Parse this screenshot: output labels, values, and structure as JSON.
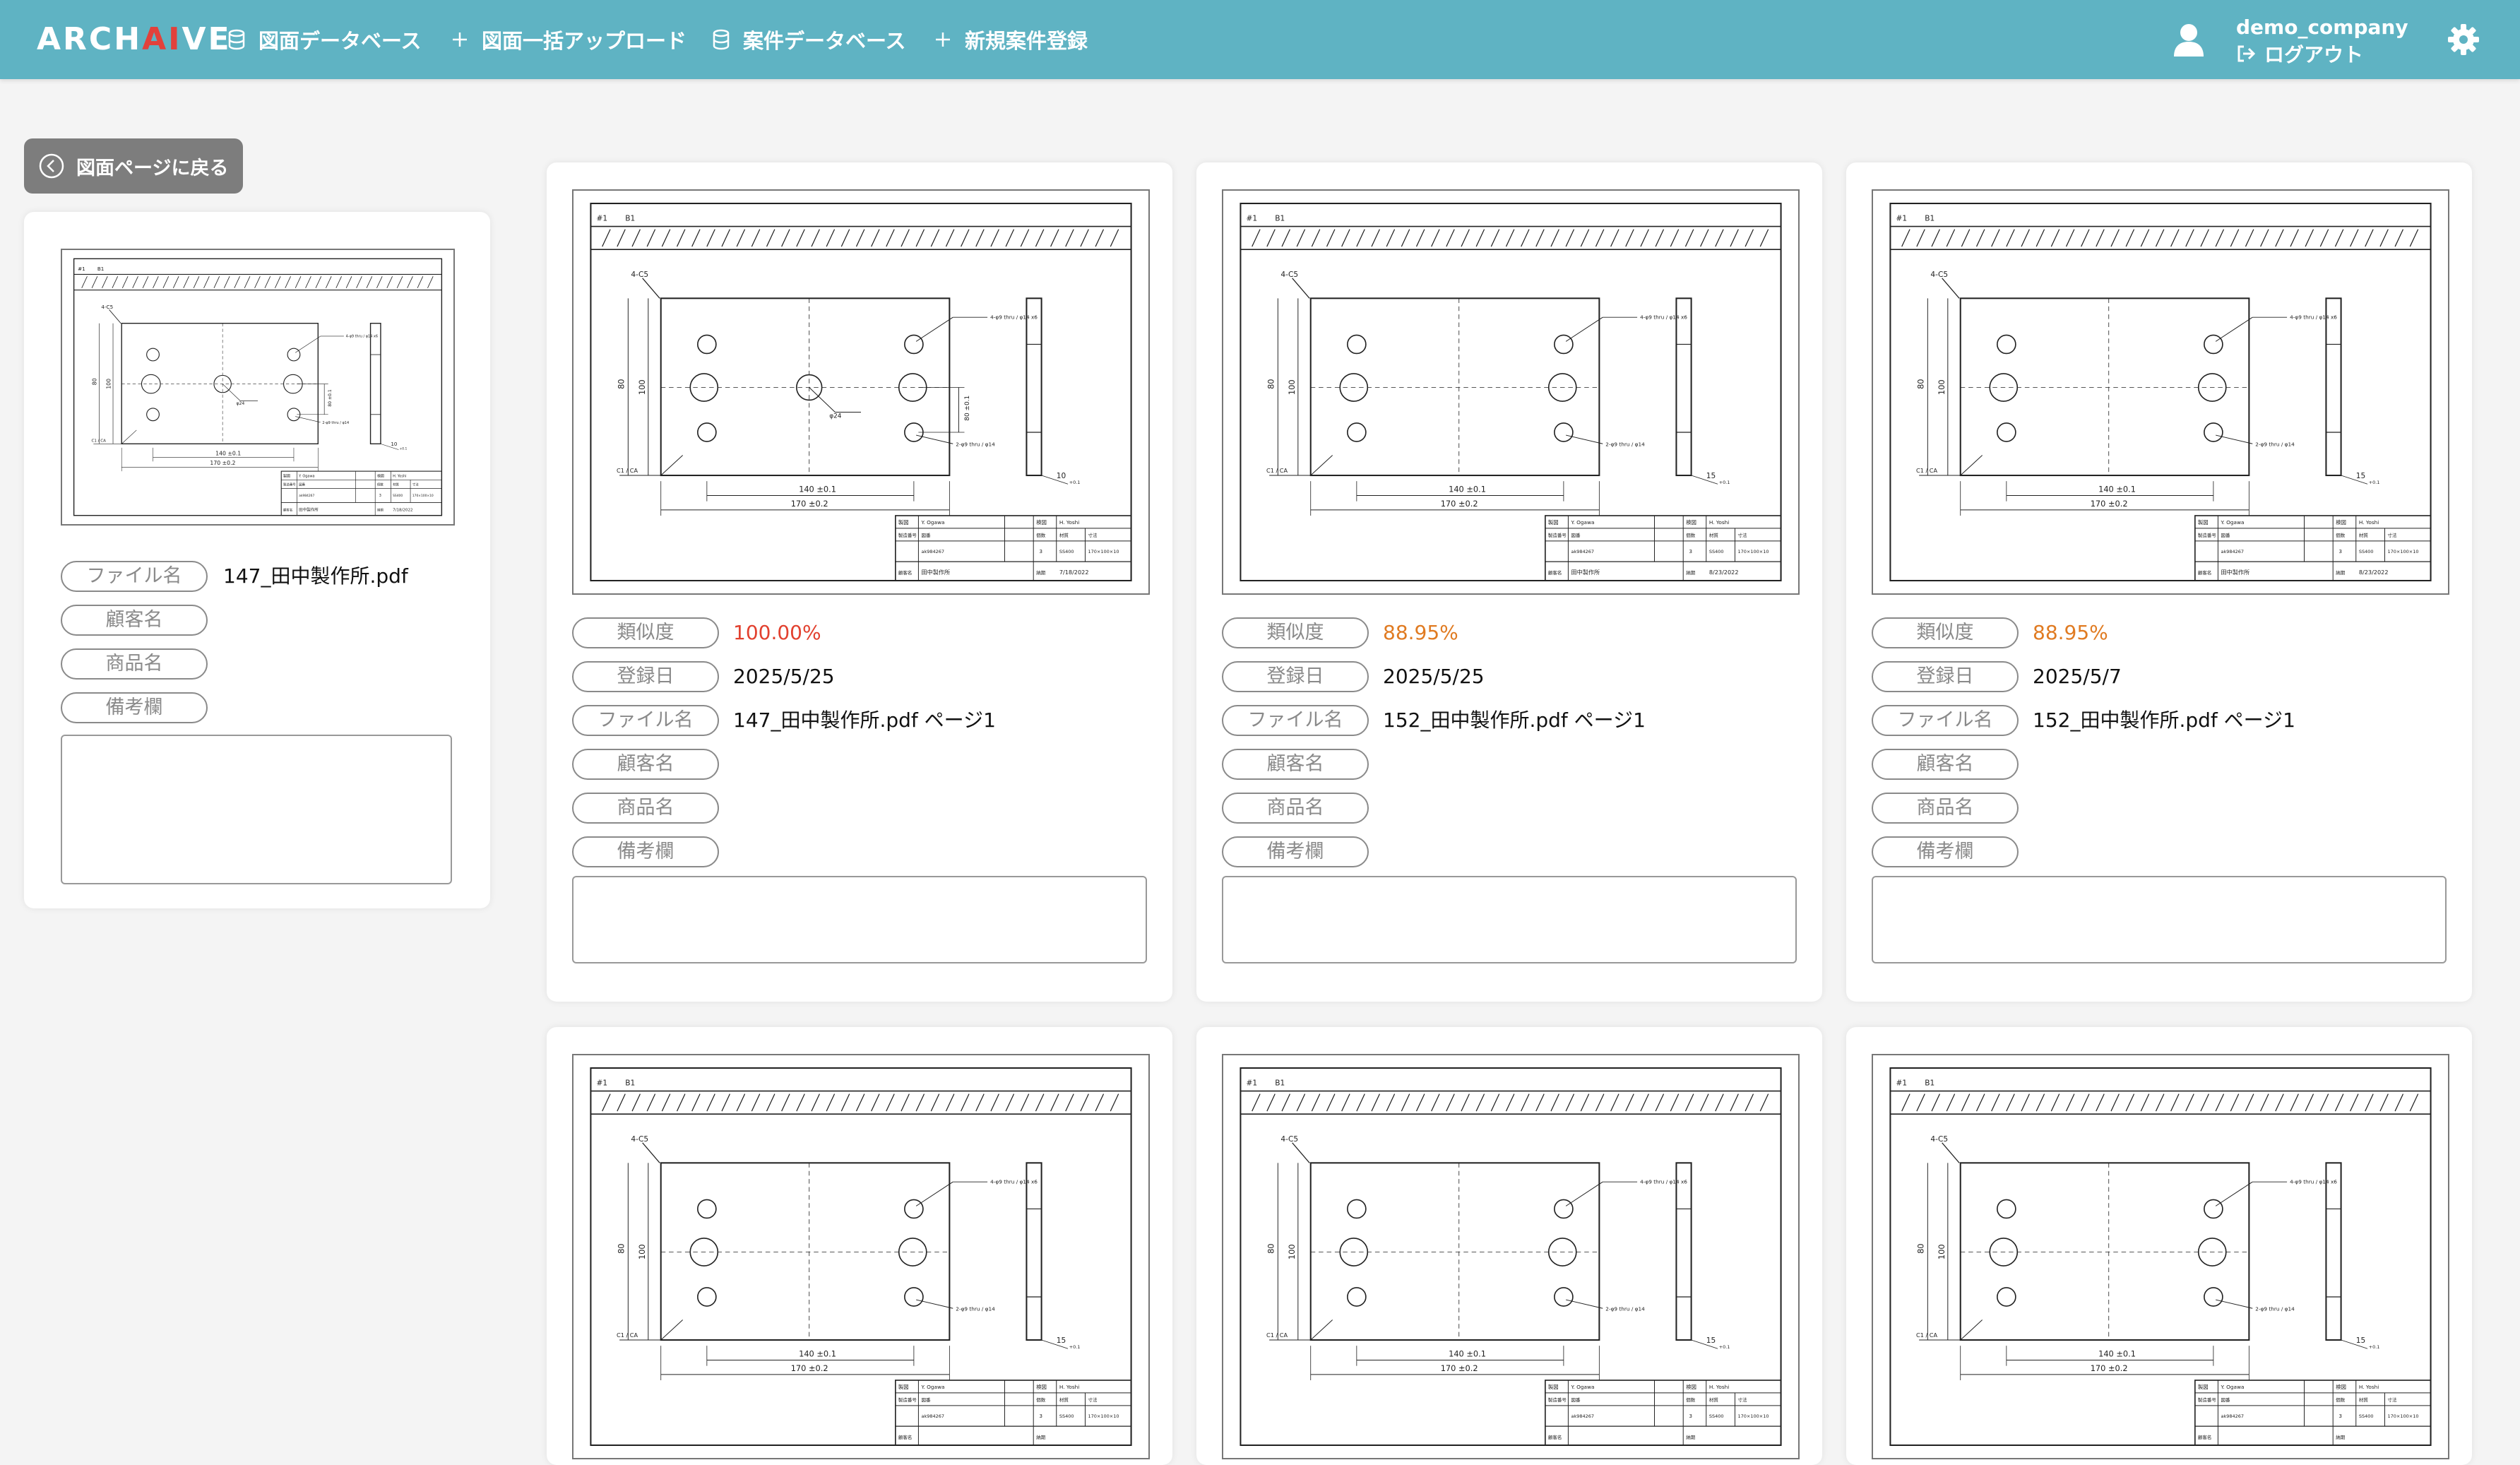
{
  "header": {
    "logo": {
      "prefix": "ARCH",
      "highlight": "AI",
      "suffix": "VE"
    },
    "nav": [
      {
        "label": "図面データベース",
        "icon": "database-icon"
      },
      {
        "label": "図面一括アップロード",
        "icon": "plus-icon"
      },
      {
        "label": "案件データベース",
        "icon": "database-icon"
      },
      {
        "label": "新規案件登録",
        "icon": "plus-icon"
      }
    ],
    "user": {
      "name": "demo_company",
      "logout_label": "ログアウト"
    }
  },
  "back_button": {
    "label": "図面ページに戻る"
  },
  "source": {
    "fields": [
      {
        "label": "ファイル名",
        "value": "147_田中製作所.pdf"
      },
      {
        "label": "顧客名",
        "value": ""
      },
      {
        "label": "商品名",
        "value": ""
      },
      {
        "label": "備考欄",
        "value": ""
      }
    ],
    "drawing": {
      "width_dim": "140",
      "total_dim": "170",
      "height_dim": "100",
      "inner_dim": "80",
      "thickness": "10",
      "date": "7/18/2022",
      "company": "田中製作所"
    }
  },
  "results": [
    {
      "similarity_label": "類似度",
      "similarity": "100.00%",
      "level": "red",
      "fields": [
        {
          "label": "登録日",
          "value": "2025/5/25"
        },
        {
          "label": "ファイル名",
          "value": "147_田中製作所.pdf ページ1"
        },
        {
          "label": "顧客名",
          "value": ""
        },
        {
          "label": "商品名",
          "value": ""
        },
        {
          "label": "備考欄",
          "value": ""
        }
      ],
      "drawing": {
        "width_dim": "140",
        "total_dim": "170",
        "height_dim": "100",
        "inner_dim": "80",
        "thickness": "10",
        "date": "7/18/2022",
        "company": "田中製作所"
      }
    },
    {
      "similarity_label": "類似度",
      "similarity": "88.95%",
      "level": "orange",
      "fields": [
        {
          "label": "登録日",
          "value": "2025/5/25"
        },
        {
          "label": "ファイル名",
          "value": "152_田中製作所.pdf ページ1"
        },
        {
          "label": "顧客名",
          "value": ""
        },
        {
          "label": "商品名",
          "value": ""
        },
        {
          "label": "備考欄",
          "value": ""
        }
      ],
      "drawing": {
        "width_dim": "140",
        "total_dim": "170",
        "height_dim": "100",
        "inner_dim": "80",
        "thickness": "15",
        "date": "8/23/2022",
        "company": "田中製作所"
      }
    },
    {
      "similarity_label": "類似度",
      "similarity": "88.95%",
      "level": "orange",
      "fields": [
        {
          "label": "登録日",
          "value": "2025/5/7"
        },
        {
          "label": "ファイル名",
          "value": "152_田中製作所.pdf ページ1"
        },
        {
          "label": "顧客名",
          "value": ""
        },
        {
          "label": "商品名",
          "value": ""
        },
        {
          "label": "備考欄",
          "value": ""
        }
      ],
      "drawing": {
        "width_dim": "140",
        "total_dim": "170",
        "height_dim": "100",
        "inner_dim": "80",
        "thickness": "15",
        "date": "8/23/2022",
        "company": "田中製作所"
      }
    },
    {
      "drawing": {
        "width_dim": "140",
        "total_dim": "170",
        "height_dim": "100",
        "inner_dim": "80",
        "thickness": "15"
      }
    },
    {
      "drawing": {
        "width_dim": "140",
        "total_dim": "170",
        "height_dim": "100",
        "inner_dim": "80",
        "thickness": "15"
      }
    },
    {
      "drawing": {
        "width_dim": "140",
        "total_dim": "170",
        "height_dim": "100",
        "inner_dim": "80",
        "thickness": "15"
      }
    }
  ],
  "colors": {
    "header": "#5fb3c3",
    "accent_ai": "#e2413b",
    "similarity_top": "#e2412f",
    "similarity_other": "#e07b22"
  }
}
